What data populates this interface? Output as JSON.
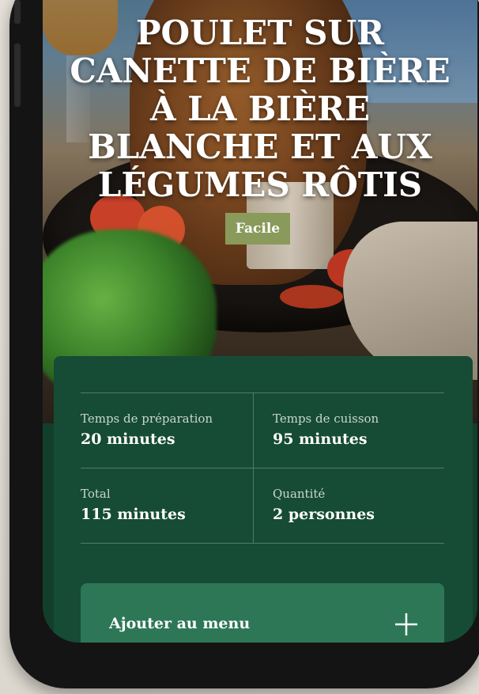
{
  "recipe": {
    "title": "POULET SUR CANETTE DE BIÈRE À LA BIÈRE BLANCHE ET AUX LÉGUMES RÔTIS",
    "difficulty": "Facile"
  },
  "info": {
    "prep_label": "Temps de préparation",
    "prep_value": "20 minutes",
    "cook_label": "Temps de cuisson",
    "cook_value": "95 minutes",
    "total_label": "Total",
    "total_value": "115 minutes",
    "qty_label": "Quantité",
    "qty_value": "2 personnes"
  },
  "actions": {
    "add_to_menu": "Ajouter au menu",
    "add_icon": "plus-icon"
  },
  "colors": {
    "card": "#164b35",
    "button": "#2d7757",
    "badge": "#8a9a5b"
  }
}
